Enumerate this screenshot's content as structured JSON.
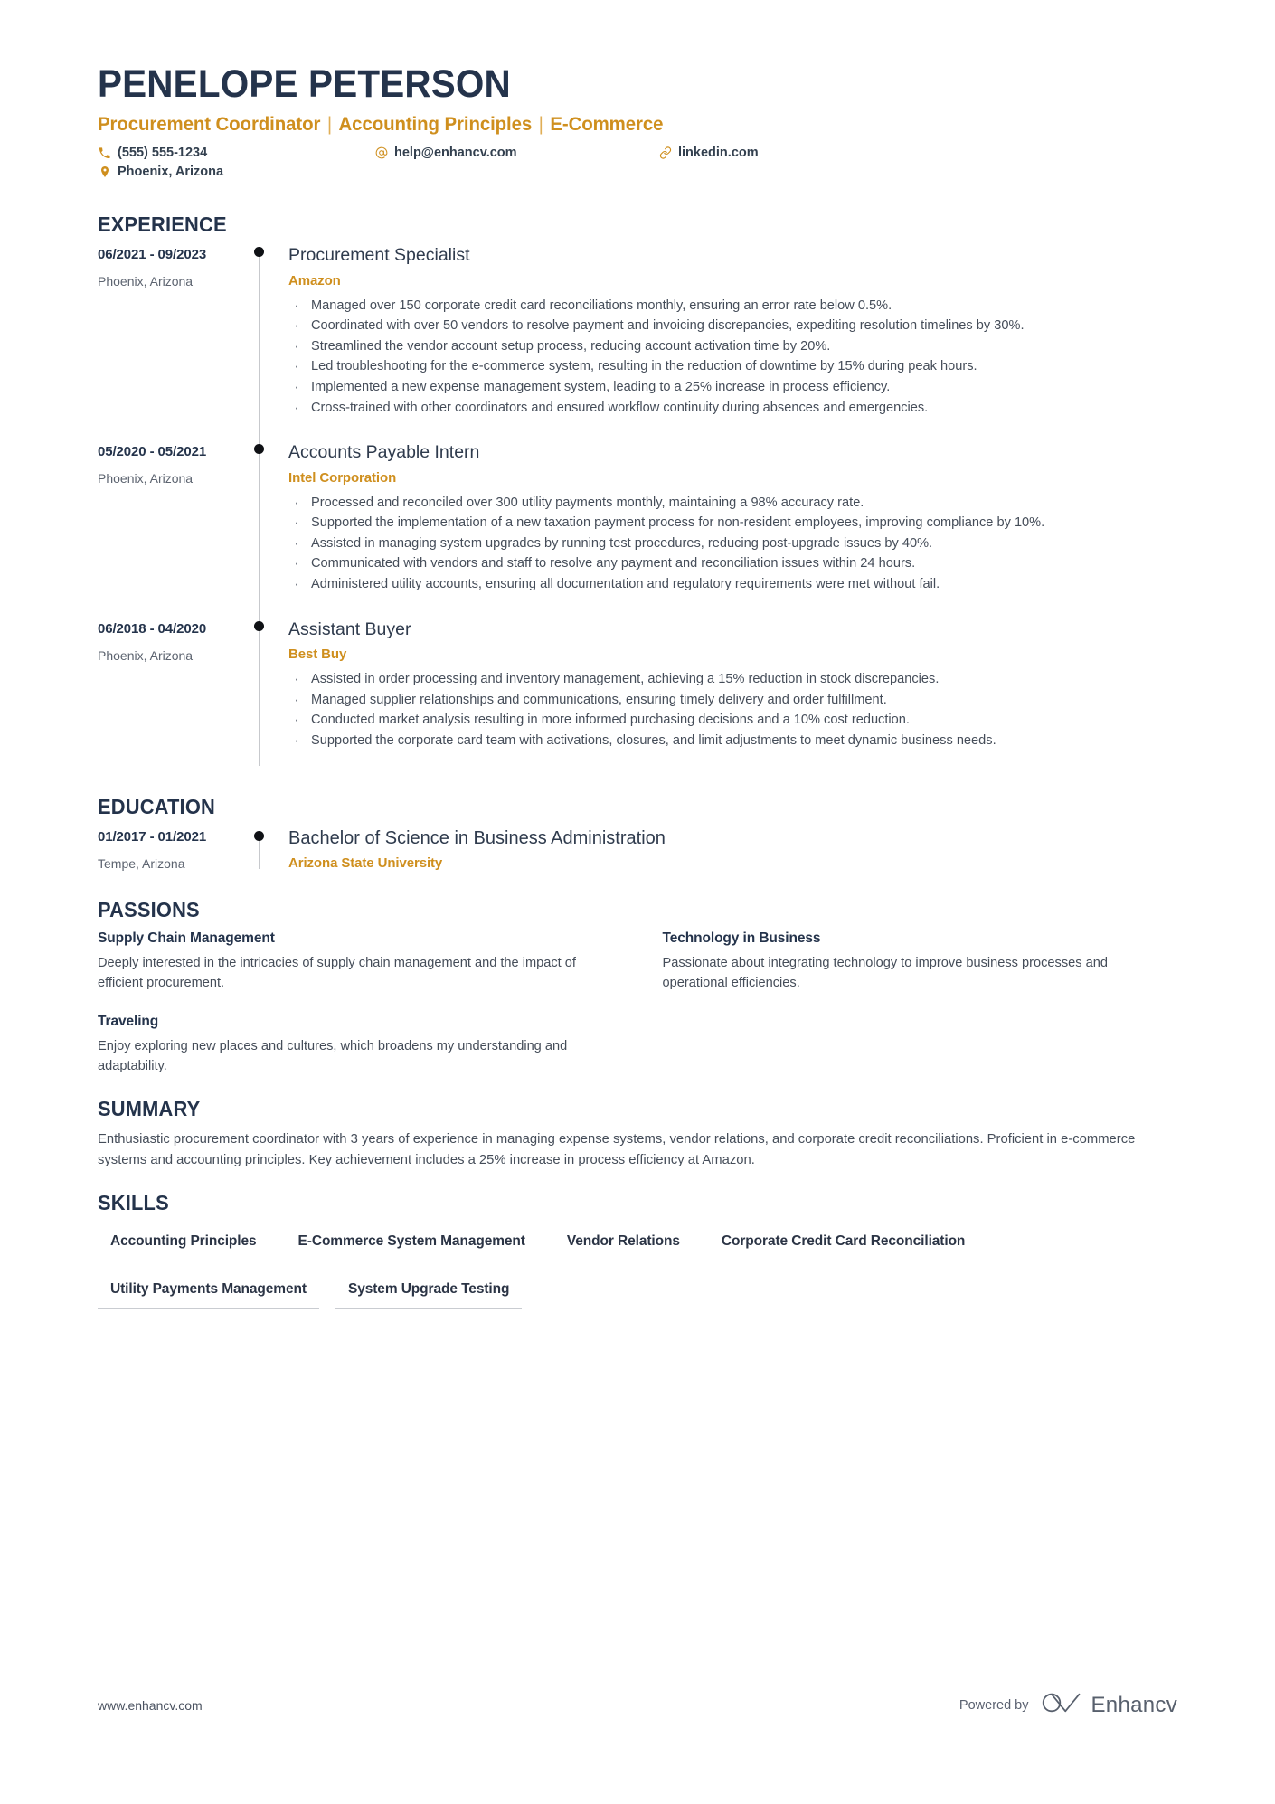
{
  "colors": {
    "accent": "#cf8f1e",
    "dark": "#24334b",
    "body": "#454d59",
    "rail": "#c7c9cd"
  },
  "header": {
    "name": "PENELOPE PETERSON",
    "headline_parts": [
      "Procurement Coordinator",
      "Accounting Principles",
      "E-Commerce"
    ],
    "headline_separator": "|",
    "contacts": {
      "phone": "(555) 555-1234",
      "email": "help@enhancv.com",
      "link": "linkedin.com",
      "location": "Phoenix, Arizona"
    },
    "icons": {
      "phone": "phone-icon",
      "email": "at-sign-icon",
      "link": "link-chain-icon",
      "location": "map-pin-icon"
    }
  },
  "sections": {
    "experience": {
      "title": "EXPERIENCE",
      "entries": [
        {
          "date": "06/2021 - 09/2023",
          "location": "Phoenix, Arizona",
          "title": "Procurement Specialist",
          "company": "Amazon",
          "bullets": [
            "Managed over 150 corporate credit card reconciliations monthly, ensuring an error rate below 0.5%.",
            "Coordinated with over 50 vendors to resolve payment and invoicing discrepancies, expediting resolution timelines by 30%.",
            "Streamlined the vendor account setup process, reducing account activation time by 20%.",
            "Led troubleshooting for the e-commerce system, resulting in the reduction of downtime by 15% during peak hours.",
            "Implemented a new expense management system, leading to a 25% increase in process efficiency.",
            "Cross-trained with other coordinators and ensured workflow continuity during absences and emergencies."
          ]
        },
        {
          "date": "05/2020 - 05/2021",
          "location": "Phoenix, Arizona",
          "title": "Accounts Payable Intern",
          "company": "Intel Corporation",
          "bullets": [
            "Processed and reconciled over 300 utility payments monthly, maintaining a 98% accuracy rate.",
            "Supported the implementation of a new taxation payment process for non-resident employees, improving compliance by 10%.",
            "Assisted in managing system upgrades by running test procedures, reducing post-upgrade issues by 40%.",
            "Communicated with vendors and staff to resolve any payment and reconciliation issues within 24 hours.",
            "Administered utility accounts, ensuring all documentation and regulatory requirements were met without fail."
          ]
        },
        {
          "date": "06/2018 - 04/2020",
          "location": "Phoenix, Arizona",
          "title": "Assistant Buyer",
          "company": "Best Buy",
          "bullets": [
            "Assisted in order processing and inventory management, achieving a 15% reduction in stock discrepancies.",
            "Managed supplier relationships and communications, ensuring timely delivery and order fulfillment.",
            "Conducted market analysis resulting in more informed purchasing decisions and a 10% cost reduction.",
            "Supported the corporate card team with activations, closures, and limit adjustments to meet dynamic business needs."
          ]
        }
      ]
    },
    "education": {
      "title": "EDUCATION",
      "entries": [
        {
          "date": "01/2017 - 01/2021",
          "location": "Tempe, Arizona",
          "title": "Bachelor of Science in Business Administration",
          "company": "Arizona State University"
        }
      ]
    },
    "passions": {
      "title": "PASSIONS",
      "items": [
        {
          "title": "Supply Chain Management",
          "description": "Deeply interested in the intricacies of supply chain management and the impact of efficient procurement."
        },
        {
          "title": "Technology in Business",
          "description": "Passionate about integrating technology to improve business processes and operational efficiencies."
        },
        {
          "title": "Traveling",
          "description": "Enjoy exploring new places and cultures, which broadens my understanding and adaptability."
        }
      ]
    },
    "summary": {
      "title": "SUMMARY",
      "text": "Enthusiastic procurement coordinator with 3 years of experience in managing expense systems, vendor relations, and corporate credit reconciliations. Proficient in e-commerce systems and accounting principles. Key achievement includes a 25% increase in process efficiency at Amazon."
    },
    "skills": {
      "title": "SKILLS",
      "items": [
        "Accounting Principles",
        "E-Commerce System Management",
        "Vendor Relations",
        "Corporate Credit Card Reconciliation",
        "Utility Payments Management",
        "System Upgrade Testing"
      ]
    }
  },
  "footer": {
    "url": "www.enhancv.com",
    "powered_by_label": "Powered by",
    "brand_name": "Enhancv",
    "brand_logo_icon": "enhancv-infinity-logo"
  }
}
